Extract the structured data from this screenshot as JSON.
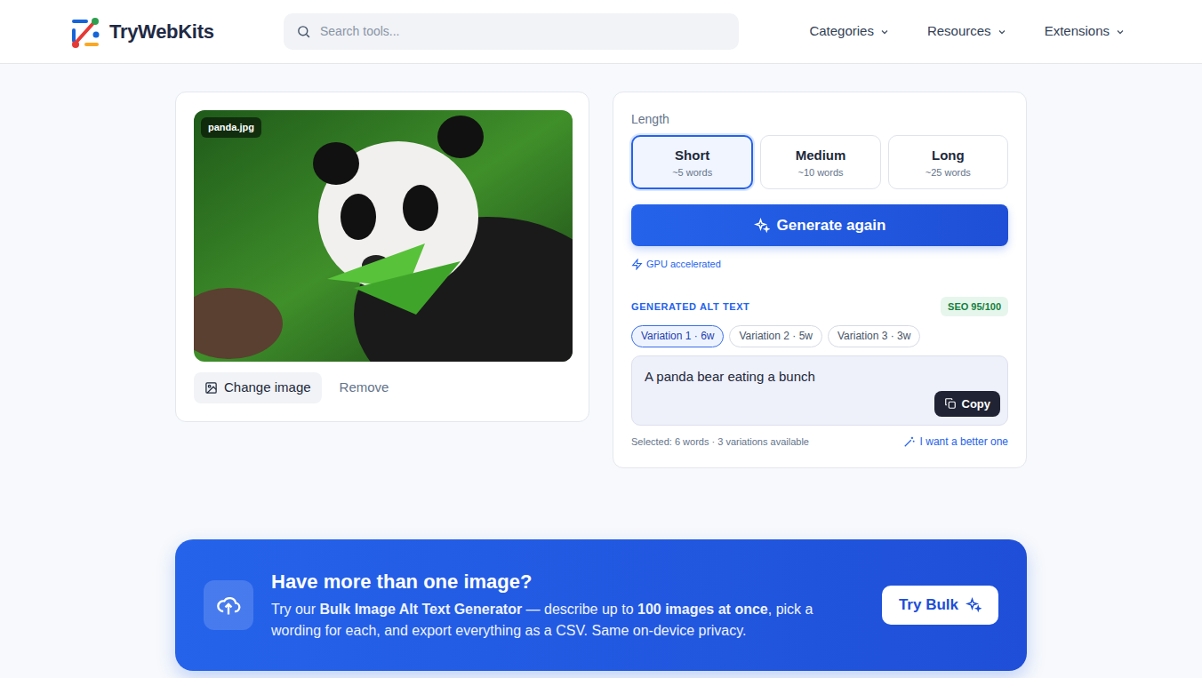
{
  "header": {
    "logo": "TryWebKits",
    "search": {
      "placeholder": "Search tools..."
    },
    "nav": [
      {
        "label": "Categories"
      },
      {
        "label": "Resources"
      },
      {
        "label": "Extensions"
      }
    ]
  },
  "upload": {
    "filename": "panda.jpg",
    "change_button": "Change image",
    "remove_button": "Remove"
  },
  "generator": {
    "length_label": "Length",
    "lengths": [
      {
        "label": "Short",
        "hint": "~5 words",
        "selected": true
      },
      {
        "label": "Medium",
        "hint": "~10 words",
        "selected": false
      },
      {
        "label": "Long",
        "hint": "~25 words",
        "selected": false
      }
    ],
    "generate_button": "Generate again",
    "gpu_note": "GPU accelerated",
    "result_title": "GENERATED ALT TEXT",
    "seo_score": "SEO 95/100",
    "variations": [
      {
        "label": "Variation 1 · 6w",
        "selected": true
      },
      {
        "label": "Variation 2 · 5w",
        "selected": false
      },
      {
        "label": "Variation 3 · 3w",
        "selected": false
      }
    ],
    "alt_text": "A panda bear eating a bunch",
    "copy_button": "Copy",
    "summary": "Selected: 6 words · 3 variations available",
    "better_link": "I want a better one"
  },
  "banner": {
    "title": "Have more than one image?",
    "text": [
      {
        "text": "Try our ",
        "bold": false
      },
      {
        "text": "Bulk Image Alt Text Generator",
        "bold": true
      },
      {
        "text": " — describe up to ",
        "bold": false
      },
      {
        "text": "100 images at once",
        "bold": true
      },
      {
        "text": ", pick a wording for each, and export everything as a CSV. Same on-device privacy.",
        "bold": false
      }
    ],
    "button": "Try Bulk"
  }
}
